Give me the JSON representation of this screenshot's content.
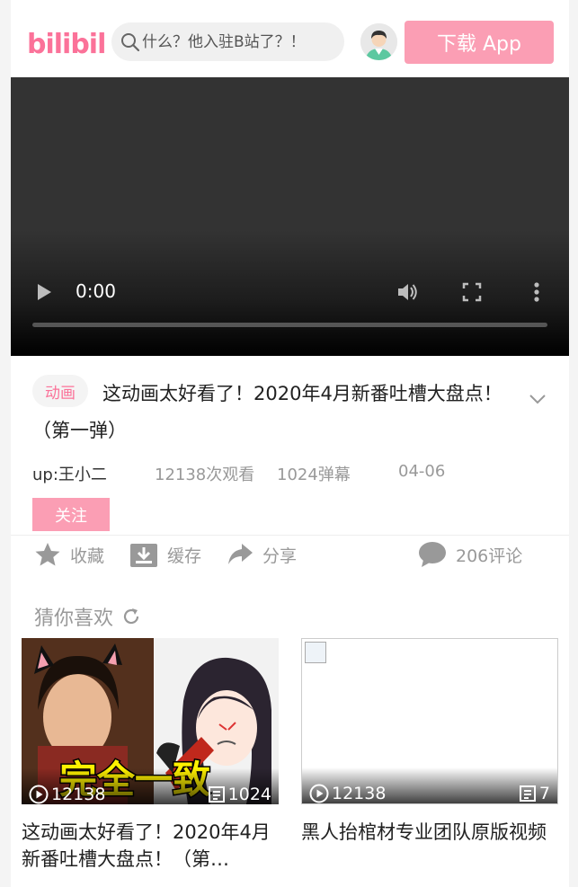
{
  "header": {
    "logo_text": "bilibili",
    "search_placeholder": "什么？他入驻B站了？！",
    "download_label": "下载 App"
  },
  "player": {
    "time": "0:00",
    "progress_fraction": 0
  },
  "video": {
    "tag": "动画",
    "title": "这动画太好看了！2020年4月新番吐槽大盘点！（第一弹）",
    "uploader": "up:王小二",
    "views": "12138次观看",
    "danmaku": "1024弹幕",
    "date": "04-06",
    "follow_label": "关注"
  },
  "actions": {
    "favorite": "收藏",
    "cache": "缓存",
    "share": "分享",
    "comments": "206评论"
  },
  "recommend": {
    "heading": "猜你喜欢",
    "cards": [
      {
        "caption": "完全一致",
        "plays": "12138",
        "danmaku": "1024",
        "title": "这动画太好看了！2020年4月新番吐槽大盘点！（第…"
      },
      {
        "plays": "12138",
        "danmaku": "7",
        "title": "黑人抬棺材专业团队原版视频"
      }
    ]
  },
  "colors": {
    "brand_pink": "#fb7299",
    "button_pink": "#fb9eb4"
  }
}
